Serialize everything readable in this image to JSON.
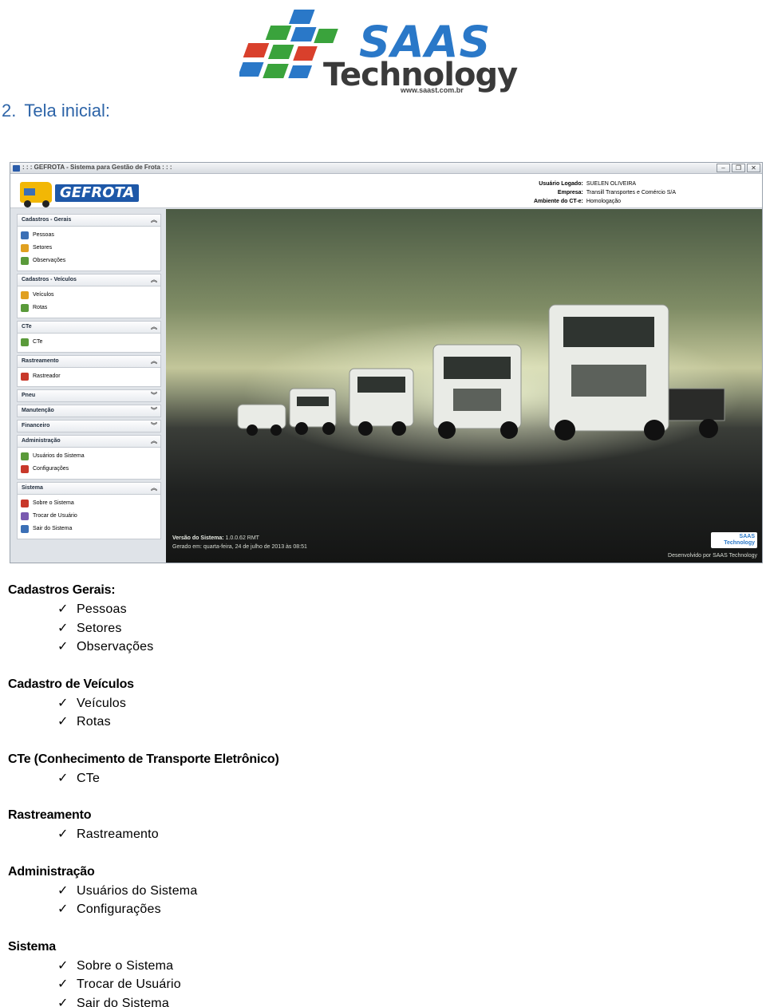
{
  "logo": {
    "brand": "SAAS",
    "sub": "Technology",
    "url": "www.saast.com.br"
  },
  "heading": {
    "number": "2.",
    "title": "Tela inicial:"
  },
  "screenshot": {
    "window_title": ": : : GEFROTA - Sistema para Gestão de Frota : : :",
    "app_logo": "GEFROTA",
    "user": {
      "label_user": "Usuário Logado:",
      "value_user": "SUELEN OLIVEIRA",
      "label_company": "Empresa:",
      "value_company": "Transill Transportes e Comércio S/A",
      "label_env": "Ambiente do CT-e:",
      "value_env": "Homologação"
    },
    "sidebar": [
      {
        "title": "Cadastros - Gerais",
        "items": [
          "Pessoas",
          "Setores",
          "Observações"
        ]
      },
      {
        "title": "Cadastros - Veículos",
        "items": [
          "Veículos",
          "Rotas"
        ]
      },
      {
        "title": "CTe",
        "items": [
          "CTe"
        ]
      },
      {
        "title": "Rastreamento",
        "items": [
          "Rastreador"
        ]
      },
      {
        "title": "Pneu",
        "items": []
      },
      {
        "title": "Manutenção",
        "items": []
      },
      {
        "title": "Financeiro",
        "items": []
      },
      {
        "title": "Administração",
        "items": [
          "Usuários do Sistema",
          "Configurações"
        ]
      },
      {
        "title": "Sistema",
        "items": [
          "Sobre o Sistema",
          "Trocar de Usuário",
          "Sair do Sistema"
        ]
      }
    ],
    "footer": {
      "version_label": "Versão do Sistema:",
      "version": "1.0.0.62 RMT",
      "generated": "Gerado em: quarta-feira, 24 de julho de 2013 às 08:51",
      "badge": "SAAS Technology",
      "credit": "Desenvolvido por SAAS Technology"
    }
  },
  "list": [
    {
      "title": "Cadastros Gerais:",
      "items": [
        "Pessoas",
        "Setores",
        "Observações"
      ]
    },
    {
      "title": "Cadastro de Veículos",
      "items": [
        "Veículos",
        "Rotas"
      ]
    },
    {
      "title": "CTe (Conhecimento de Transporte Eletrônico)",
      "items": [
        "CTe"
      ]
    },
    {
      "title": "Rastreamento",
      "items": [
        "Rastreamento"
      ]
    },
    {
      "title": "Administração",
      "items": [
        "Usuários do Sistema",
        "Configurações"
      ]
    },
    {
      "title": "Sistema",
      "items": [
        "Sobre o Sistema",
        "Trocar de Usuário",
        "Sair do Sistema"
      ]
    }
  ],
  "colors": {
    "heading": "#2d64a8",
    "brand_blue": "#2a78c8",
    "brand_green": "#3aa33c",
    "brand_red": "#d9402c"
  },
  "check_glyph": "✓"
}
